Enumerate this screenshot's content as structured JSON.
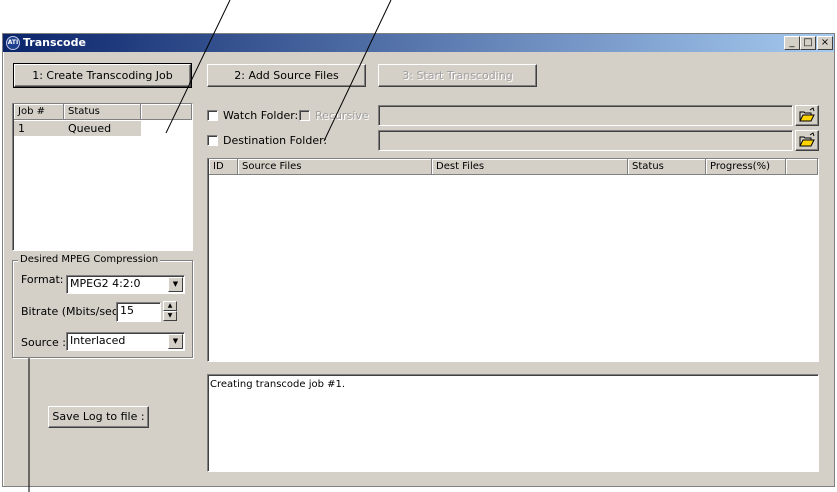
{
  "window": {
    "title": "Transcode",
    "icon": "app-logo-icon"
  },
  "caption_buttons": {
    "minimize": "_",
    "maximize": "□",
    "close": "×"
  },
  "toolbar": {
    "create_job": "1: Create Transcoding Job",
    "add_source": "2: Add Source Files",
    "start": "3: Start Transcoding"
  },
  "jobs": {
    "columns": [
      "Job #",
      "Status"
    ],
    "rows": [
      {
        "job": "1",
        "status": "Queued"
      }
    ]
  },
  "folders": {
    "watch_label": "Watch Folder:",
    "recursive_label": "Recursive",
    "dest_label": "Destination Folder:",
    "watch_path": "",
    "dest_path": ""
  },
  "files": {
    "columns": [
      "ID",
      "Source Files",
      "Dest Files",
      "Status",
      "Progress(%)"
    ]
  },
  "compression": {
    "group_label": "Desired MPEG Compression",
    "format_label": "Format:",
    "format_value": "MPEG2 4:2:0",
    "bitrate_label": "Bitrate (Mbits/sec)",
    "bitrate_value": "15",
    "source_label": "Source :",
    "source_value": "Interlaced"
  },
  "log": {
    "save_button": "Save Log to file :",
    "text": "Creating transcode job #1."
  }
}
